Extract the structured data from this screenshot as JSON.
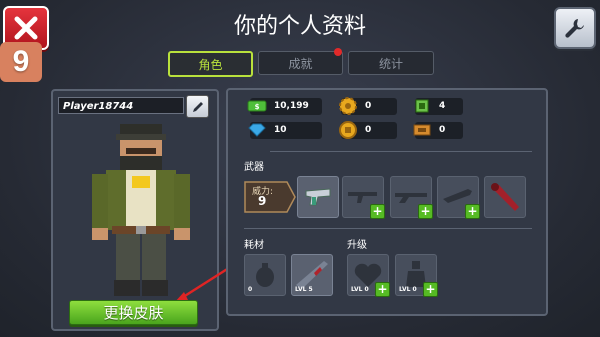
{
  "header": {
    "title": "你的个人资料",
    "age_rating": "9"
  },
  "tabs": [
    {
      "label": "角色",
      "active": true
    },
    {
      "label": "成就",
      "active": false,
      "has_notification": true
    },
    {
      "label": "统计",
      "active": false
    }
  ],
  "profile": {
    "player_name": "Player18744",
    "change_skin_label": "更换皮肤"
  },
  "stats": [
    {
      "icon": "cash-icon",
      "value": "10,199",
      "color": "#4fbf3a"
    },
    {
      "icon": "gear-coin-icon",
      "value": "0",
      "color": "#e8a81e"
    },
    {
      "icon": "chip-icon",
      "value": "4",
      "color": "#6cc24a"
    },
    {
      "icon": "gem-icon",
      "value": "10",
      "color": "#3aa8e6"
    },
    {
      "icon": "token-icon",
      "value": "0",
      "color": "#e8a81e"
    },
    {
      "icon": "ticket-icon",
      "value": "0",
      "color": "#d68b2e"
    }
  ],
  "weapons": {
    "section_label": "武器",
    "power_label": "威力:",
    "power_value": "9"
  },
  "consumables": {
    "section_label": "耗材",
    "items": [
      {
        "label": "0"
      },
      {
        "label": "LVL 5"
      }
    ]
  },
  "upgrades": {
    "section_label": "升级",
    "items": [
      {
        "label": "LVL 0"
      },
      {
        "label": "LVL 0"
      }
    ]
  },
  "colors": {
    "accent_green": "#b9e13c",
    "button_green": "#5cbf2a",
    "close_red": "#d3242d"
  }
}
